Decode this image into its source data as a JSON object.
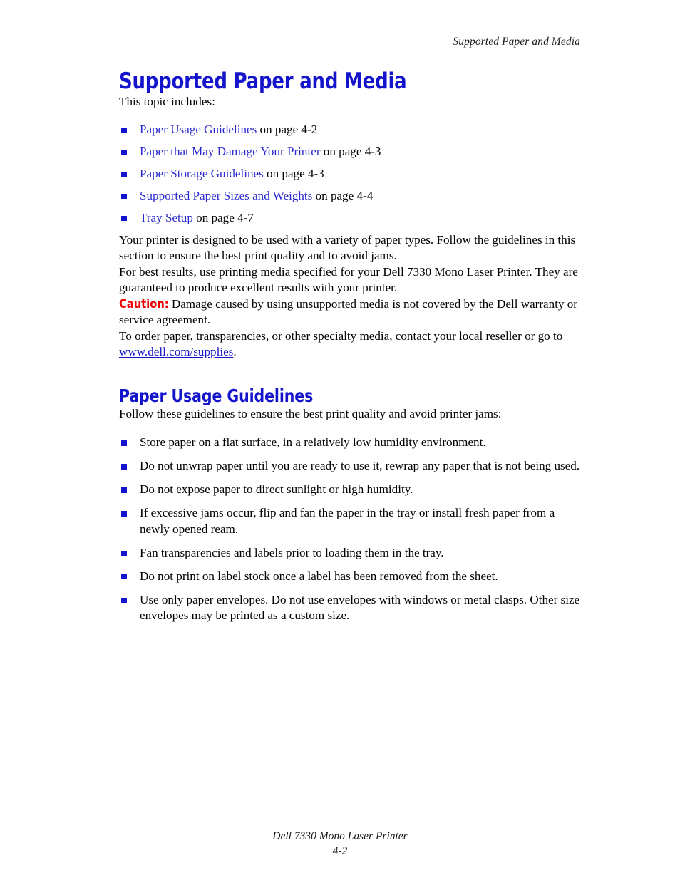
{
  "header": {
    "running_title": "Supported Paper and Media"
  },
  "colors": {
    "heading_blue": "#1414CC",
    "link_blue": "#2A2AD0",
    "caution_red": "#EE0000",
    "bullet_blue": "#1414CC",
    "text_black": "#000000",
    "page_background": "#FFFFFF"
  },
  "main": {
    "title": "Supported Paper and Media",
    "intro_line": "This topic includes:",
    "toc": [
      {
        "link": "Paper Usage Guidelines",
        "suffix": " on page 4-2"
      },
      {
        "link": "Paper that May Damage Your Printer",
        "suffix": " on page 4-3"
      },
      {
        "link": "Paper Storage Guidelines",
        "suffix": " on page 4-3"
      },
      {
        "link": "Supported Paper Sizes and Weights",
        "suffix": " on page 4-4"
      },
      {
        "link": "Tray Setup",
        "suffix": " on page 4-7"
      }
    ],
    "paragraph_1": "Your printer is designed to be used with a variety of paper types. Follow the guidelines in this section to ensure the best print quality and to avoid jams.",
    "paragraph_2": "For best results, use printing media specified for your Dell 7330 Mono Laser Printer. They are guaranteed to produce excellent results with your printer.",
    "caution": {
      "label": "Caution:",
      "text": " Damage caused by using unsupported media is not covered by the Dell warranty or service agreement."
    },
    "order_paragraph": {
      "lead": "To order paper, transparencies, or other specialty media, contact your local reseller or go to ",
      "url_text": "www.dell.com/supplies",
      "trailing": "."
    },
    "section_2": {
      "title": "Paper Usage Guidelines",
      "intro": "Follow these guidelines to ensure the best print quality and avoid printer jams:",
      "guidelines": [
        "Store paper on a flat surface, in a relatively low humidity environment.",
        "Do not unwrap paper until you are ready to use it, rewrap any paper that is not being used.",
        "Do not expose paper to direct sunlight or high humidity.",
        "If excessive jams occur, flip and fan the paper in the tray or install fresh paper from a newly opened ream.",
        "Fan transparencies and labels prior to loading them in the tray.",
        "Do not print on label stock once a label has been removed from the sheet.",
        "Use only paper envelopes. Do not use envelopes with windows or metal clasps. Other size envelopes may be printed as a custom size."
      ]
    }
  },
  "footer": {
    "product": "Dell 7330 Mono Laser Printer",
    "page_number": "4-2"
  }
}
